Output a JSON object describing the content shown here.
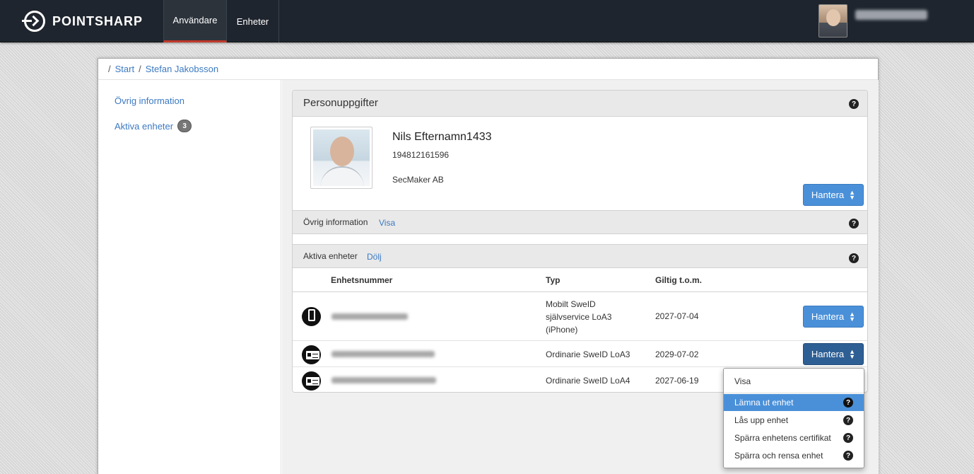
{
  "topbar": {
    "brand": "POINTSHARP",
    "tabs": [
      {
        "label": "Användare",
        "active": true
      },
      {
        "label": "Enheter",
        "active": false
      }
    ]
  },
  "breadcrumb": {
    "items": [
      "Start",
      "Stefan Jakobsson"
    ]
  },
  "sidebar": {
    "items": [
      {
        "label": "Övrig information"
      },
      {
        "label": "Aktiva enheter",
        "badge": "3"
      }
    ]
  },
  "panel": {
    "title": "Personuppgifter",
    "help_symbol": "?",
    "person": {
      "name": "Nils Efternamn1433",
      "id_number": "194812161596",
      "organization": "SecMaker AB"
    },
    "manage_label": "Hantera",
    "sections": [
      {
        "label": "Övrig information",
        "link": "Visa"
      },
      {
        "label": "Aktiva enheter",
        "link": "Dölj"
      }
    ],
    "table": {
      "columns": [
        "Enhetsnummer",
        "Typ",
        "Giltig t.o.m."
      ],
      "rows": [
        {
          "icon": "smartphone-icon",
          "type_lines": [
            "Mobilt SweID",
            "självservice LoA3",
            "(iPhone)"
          ],
          "valid_until": "2027-07-04"
        },
        {
          "icon": "id-card-icon",
          "type_lines": [
            "Ordinarie SweID LoA3"
          ],
          "valid_until": "2029-07-02"
        },
        {
          "icon": "id-card-icon",
          "type_lines": [
            "Ordinarie SweID LoA4"
          ],
          "valid_until": "2027-06-19"
        }
      ]
    }
  },
  "dropdown": {
    "items": [
      {
        "label": "Visa",
        "help": false,
        "active": false
      },
      {
        "label": "Lämna ut enhet",
        "help": true,
        "active": true
      },
      {
        "label": "Lås upp enhet",
        "help": true,
        "active": false
      },
      {
        "label": "Spärra enhetens certifikat",
        "help": true,
        "active": false
      },
      {
        "label": "Spärra och rensa enhet",
        "help": true,
        "active": false
      }
    ]
  },
  "colors": {
    "topbar_bg": "#1f252e",
    "accent_blue": "#4a90d9",
    "active_tab_underline": "#c0392b",
    "link": "#3c7ac2"
  }
}
